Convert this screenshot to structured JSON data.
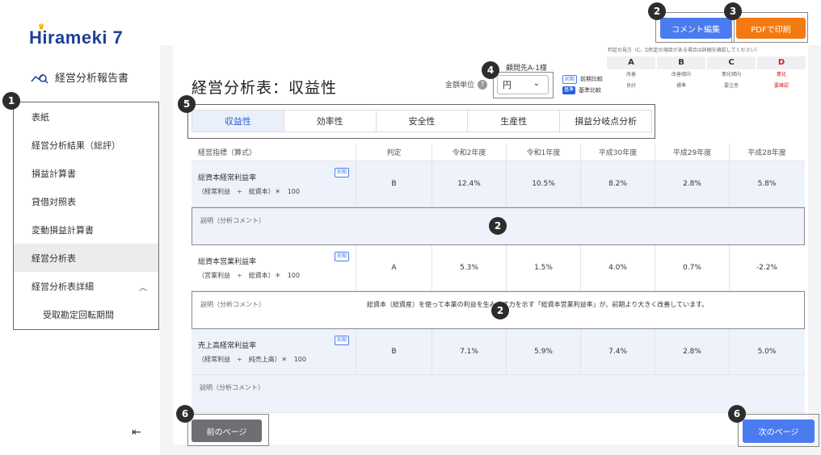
{
  "sidebar": {
    "logo": "Hirameki 7",
    "report_title": "経営分析報告書",
    "items": [
      {
        "label": "表紙"
      },
      {
        "label": "経営分析結果（総評）"
      },
      {
        "label": "損益計算書"
      },
      {
        "label": "貸借対照表"
      },
      {
        "label": "変動損益計算書"
      },
      {
        "label": "経営分析表"
      },
      {
        "label": "経営分析表詳細"
      },
      {
        "label": "受取勘定回転期間"
      }
    ],
    "active_index": 5,
    "collapse_glyph": "⇤"
  },
  "toolbar": {
    "comment_edit_label": "コメント編集",
    "pdf_print_label": "PDFで印刷"
  },
  "header": {
    "title": "経営分析表：収益性",
    "client": "顧問先A-1様",
    "unit_label": "金額単位",
    "unit_value": "円"
  },
  "legend": {
    "prev_tag": "前期",
    "prev_text": "前期比較",
    "base_tag": "基準",
    "base_text": "基準比較"
  },
  "grade_guide": {
    "note": "判定の見方（C、D判定の項目がある場合は詳細を確認してください）",
    "grades": [
      {
        "grade": "A",
        "prev": "改善",
        "base": "良好"
      },
      {
        "grade": "B",
        "prev": "改善傾向",
        "base": "標準"
      },
      {
        "grade": "C",
        "prev": "悪化傾向",
        "base": "要注意"
      },
      {
        "grade": "D",
        "prev": "悪化",
        "base": "要確認"
      }
    ]
  },
  "tabs": [
    "収益性",
    "効率性",
    "安全性",
    "生産性",
    "損益分岐点分析"
  ],
  "table": {
    "headers": [
      "経営指標（算式）",
      "判定",
      "令和2年度",
      "令和1年度",
      "平成30年度",
      "平成29年度",
      "平成28年度"
    ],
    "rows": [
      {
        "name": "総資本経常利益率",
        "formula": "（経常利益　÷　総資本）＊　100",
        "tag": "前期",
        "judge": "B",
        "values": [
          "12.4%",
          "10.5%",
          "8.2%",
          "2.8%",
          "5.8%"
        ],
        "comment_label": "説明（分析コメント）",
        "comment": ""
      },
      {
        "name": "総資本営業利益率",
        "formula": "（営業利益　÷　総資本）＊　100",
        "tag": "前期",
        "judge": "A",
        "values": [
          "5.3%",
          "1.5%",
          "4.0%",
          "0.7%",
          "-2.2%"
        ],
        "comment_label": "説明（分析コメント）",
        "comment": "総資本（総資産）を使って本業の利益を生み出す力を示す「総資本営業利益率」が、前期より大きく改善しています。"
      },
      {
        "name": "売上高経常利益率",
        "formula": "（経常利益　÷　純売上高）＊　100",
        "tag": "前期",
        "judge": "B",
        "values": [
          "7.1%",
          "5.9%",
          "7.4%",
          "2.8%",
          "5.0%"
        ],
        "comment_label": "説明（分析コメント）",
        "comment": ""
      }
    ]
  },
  "footer": {
    "prev_label": "前のページ",
    "next_label": "次のページ"
  },
  "badges": [
    "1",
    "2",
    "3",
    "4",
    "5",
    "2",
    "2",
    "6",
    "6"
  ]
}
